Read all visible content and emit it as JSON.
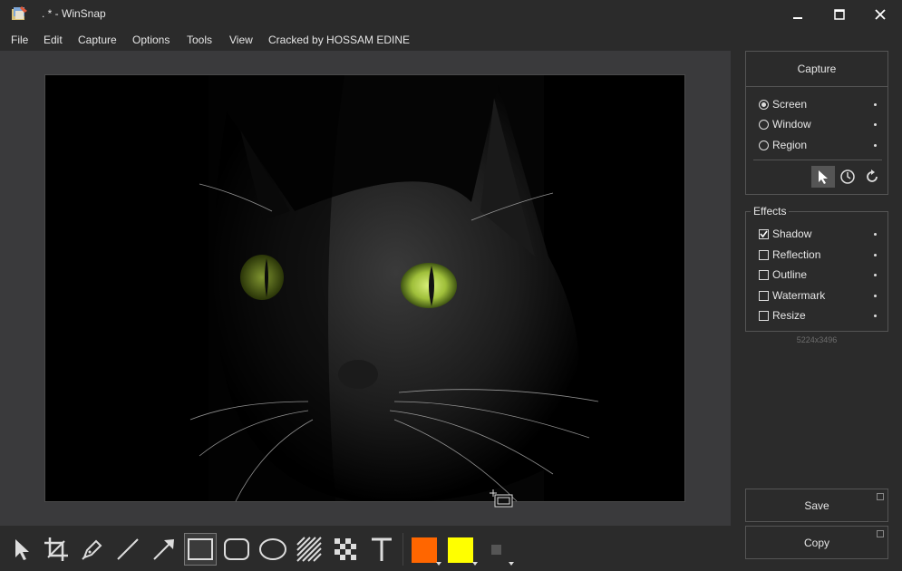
{
  "window": {
    "title": ". * -  WinSnap"
  },
  "menu": [
    "File",
    "Edit",
    "Capture",
    "Options",
    "Tools",
    "View",
    "Cracked by HOSSAM EDINE"
  ],
  "capture_panel": {
    "title": "Capture",
    "modes": [
      {
        "label": "Screen",
        "selected": true
      },
      {
        "label": "Window",
        "selected": false
      },
      {
        "label": "Region",
        "selected": false
      }
    ]
  },
  "effects": {
    "title": "Effects",
    "items": [
      {
        "label": "Shadow",
        "checked": true
      },
      {
        "label": "Reflection",
        "checked": false
      },
      {
        "label": "Outline",
        "checked": false
      },
      {
        "label": "Watermark",
        "checked": false
      },
      {
        "label": "Resize",
        "checked": false
      }
    ]
  },
  "image_size": "5224x3496",
  "actions": {
    "save": "Save",
    "copy": "Copy"
  },
  "tools": [
    "pointer-icon",
    "crop-icon",
    "pen-icon",
    "line-icon",
    "arrow-icon",
    "rectangle-icon",
    "rounded-rectangle-icon",
    "ellipse-icon",
    "hatch-icon",
    "pixelate-icon",
    "text-icon"
  ],
  "colors": {
    "primary": "#ff6600",
    "secondary": "#ffff00",
    "accent_panel": "#2b2b2b"
  }
}
